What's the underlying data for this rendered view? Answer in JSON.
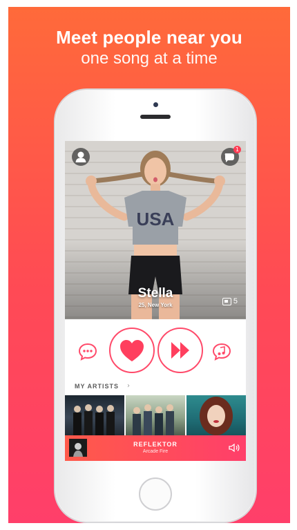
{
  "headline": {
    "line1": "Meet people near you",
    "line2": "one song at a time"
  },
  "profile": {
    "name": "Stella",
    "details": "25, New York",
    "photo_count": "5",
    "notification_count": "1",
    "shirt_text": "USA"
  },
  "actions": {
    "chat": "chat-bubble-icon",
    "like": "heart-icon",
    "next": "fast-forward-icon",
    "music": "music-note-icon"
  },
  "artists": {
    "label": "MY ARTISTS",
    "chevron": "›"
  },
  "now_playing": {
    "title": "REFLEKTOR",
    "artist": "Arcade Fire"
  },
  "colors": {
    "accent": "#ff4a6a",
    "gradient_top": "#ff6a3a",
    "gradient_bottom": "#ff3f6a"
  }
}
